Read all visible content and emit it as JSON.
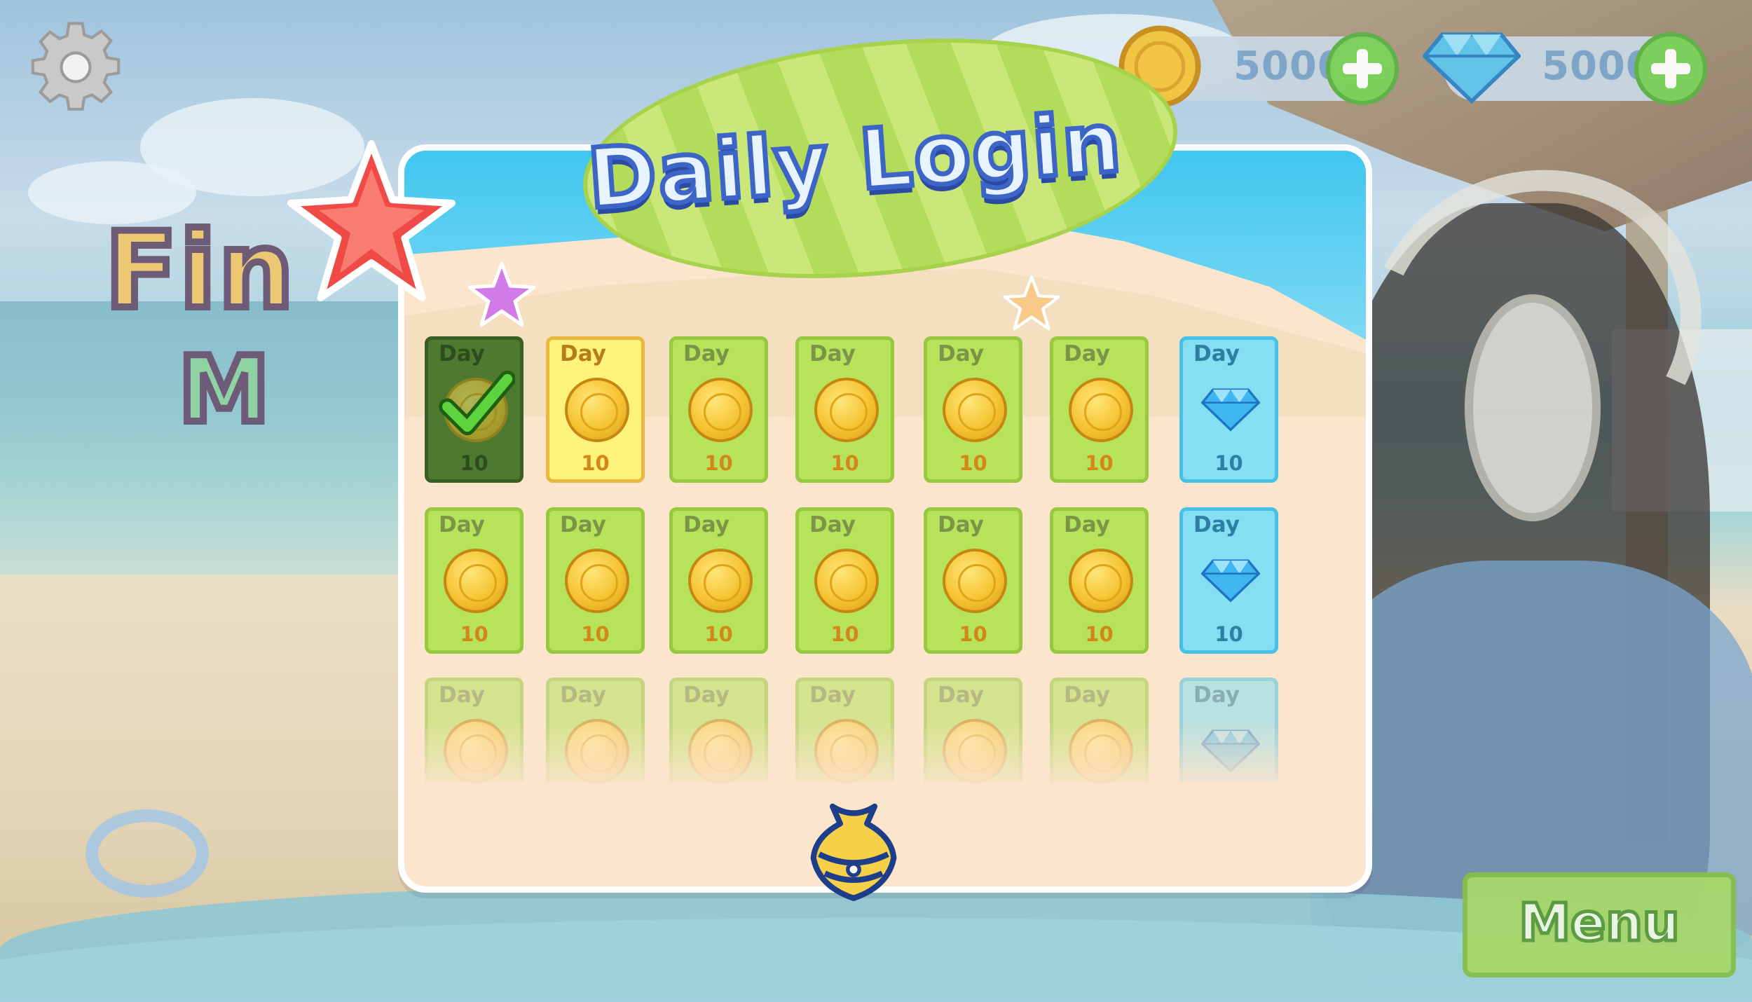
{
  "title": "Daily Login",
  "currencies": [
    {
      "icon": "coin-icon",
      "value": "5000"
    },
    {
      "icon": "diamond-icon",
      "value": "5000"
    }
  ],
  "menu_label": "Menu",
  "day_label": "Day",
  "colors": {
    "card_green": "#b6e35a",
    "card_selected": "#fdf27a",
    "card_claimed": "#4d7a30",
    "card_bonus": "#85dff2",
    "title_fill": "#e7f3ff",
    "title_outline": "#3d64c7"
  },
  "rewards": [
    [
      {
        "day": "Day",
        "reward": "coin-icon",
        "amount": "10",
        "state": "claimed"
      },
      {
        "day": "Day",
        "reward": "coin-icon",
        "amount": "10",
        "state": "current"
      },
      {
        "day": "Day",
        "reward": "coin-icon",
        "amount": "10",
        "state": "locked"
      },
      {
        "day": "Day",
        "reward": "coin-icon",
        "amount": "10",
        "state": "locked"
      },
      {
        "day": "Day",
        "reward": "coin-icon",
        "amount": "10",
        "state": "locked"
      },
      {
        "day": "Day",
        "reward": "coin-icon",
        "amount": "10",
        "state": "locked"
      },
      {
        "day": "Day",
        "reward": "diamond-icon",
        "amount": "10",
        "state": "bonus"
      }
    ],
    [
      {
        "day": "Day",
        "reward": "coin-icon",
        "amount": "10",
        "state": "locked"
      },
      {
        "day": "Day",
        "reward": "coin-icon",
        "amount": "10",
        "state": "locked"
      },
      {
        "day": "Day",
        "reward": "coin-icon",
        "amount": "10",
        "state": "locked"
      },
      {
        "day": "Day",
        "reward": "coin-icon",
        "amount": "10",
        "state": "locked"
      },
      {
        "day": "Day",
        "reward": "coin-icon",
        "amount": "10",
        "state": "locked"
      },
      {
        "day": "Day",
        "reward": "coin-icon",
        "amount": "10",
        "state": "locked"
      },
      {
        "day": "Day",
        "reward": "diamond-icon",
        "amount": "10",
        "state": "bonus"
      }
    ],
    [
      {
        "day": "Day",
        "reward": "coin-icon",
        "amount": "",
        "state": "locked"
      },
      {
        "day": "Day",
        "reward": "coin-icon",
        "amount": "",
        "state": "locked"
      },
      {
        "day": "Day",
        "reward": "coin-icon",
        "amount": "",
        "state": "locked"
      },
      {
        "day": "Day",
        "reward": "coin-icon",
        "amount": "",
        "state": "locked"
      },
      {
        "day": "Day",
        "reward": "coin-icon",
        "amount": "",
        "state": "locked"
      },
      {
        "day": "Day",
        "reward": "coin-icon",
        "amount": "",
        "state": "locked"
      },
      {
        "day": "Day",
        "reward": "diamond-icon",
        "amount": "",
        "state": "bonus"
      }
    ]
  ]
}
